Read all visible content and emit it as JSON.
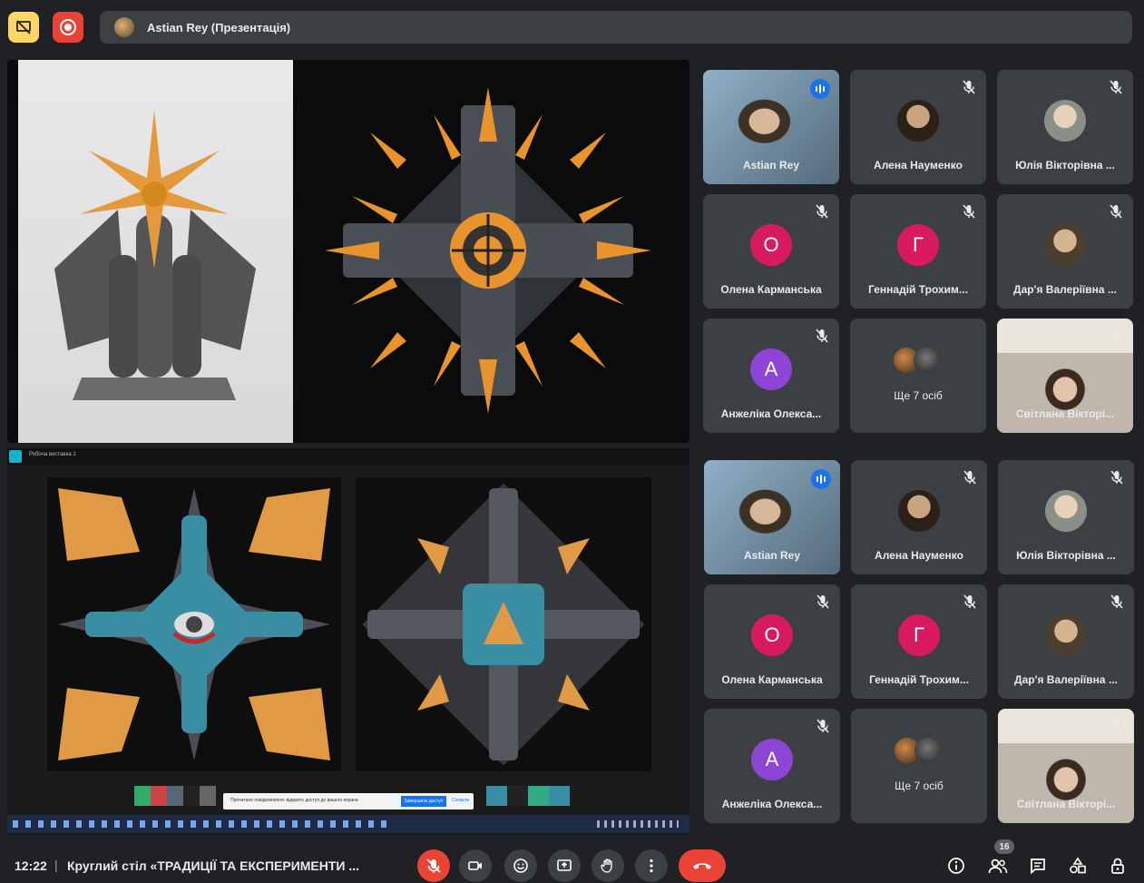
{
  "top_bar": {
    "presenter_label": "Astian Rey (Презентація)",
    "present_icon": "present-off-icon",
    "record_icon": "record-icon"
  },
  "presentation": {
    "upper_window": {
      "artworks": [
        "sculpture-photo",
        "kaleidoscope-mandala"
      ]
    },
    "lower_window": {
      "title": "Робоча виставка 1",
      "notice_text": "Прочитано повідомлення: відкрито доступ до вашого екрана",
      "notice_button": "Завершити доступ",
      "notice_dismiss": "Сховати"
    }
  },
  "participants_top": [
    {
      "name": "Astian Rey",
      "type": "video",
      "speaking": true
    },
    {
      "name": "Алена Науменко",
      "type": "photo",
      "muted": true
    },
    {
      "name": "Юлія Вікторівна ...",
      "type": "photo",
      "muted": true
    },
    {
      "name": "Олена Карманська",
      "type": "letter",
      "letter": "О",
      "color": "#d81b60",
      "muted": true
    },
    {
      "name": "Геннадій Трохим...",
      "type": "letter",
      "letter": "Г",
      "color": "#d81b60",
      "muted": true
    },
    {
      "name": "Дар'я Валеріївна ...",
      "type": "photo",
      "muted": true
    },
    {
      "name": "Анжеліка Олекса...",
      "type": "letter",
      "letter": "А",
      "color": "#8e44d4",
      "muted": true
    },
    {
      "name": "Ще 7 осіб",
      "type": "more"
    },
    {
      "name": "Світлана Вікторі...",
      "type": "video",
      "muted": true
    }
  ],
  "participants_bottom": [
    {
      "name": "Astian Rey",
      "type": "video",
      "speaking": true
    },
    {
      "name": "Алена Науменко",
      "type": "photo",
      "muted": true
    },
    {
      "name": "Юлія Вікторівна ...",
      "type": "photo",
      "muted": true
    },
    {
      "name": "Олена Карманська",
      "type": "letter",
      "letter": "О",
      "color": "#d81b60",
      "muted": true
    },
    {
      "name": "Геннадій Трохим...",
      "type": "letter",
      "letter": "Г",
      "color": "#d81b60",
      "muted": true
    },
    {
      "name": "Дар'я Валеріївна ...",
      "type": "photo",
      "muted": true
    },
    {
      "name": "Анжеліка Олекса...",
      "type": "letter",
      "letter": "А",
      "color": "#8e44d4",
      "muted": true
    },
    {
      "name": "Ще 7 осіб",
      "type": "more"
    },
    {
      "name": "Світлана Вікторі...",
      "type": "video",
      "muted": true
    }
  ],
  "bottom_bar": {
    "time": "12:22",
    "separator": "|",
    "meeting_title": "Круглий стіл «ТРАДИЦІЇ ТА ЕКСПЕРИМЕНТИ ...",
    "participants_count": "16",
    "controls": [
      "mic-off-icon",
      "camera-off-icon",
      "emoji-icon",
      "present-icon",
      "raise-hand-icon",
      "more-options-icon",
      "hang-up-icon"
    ],
    "right_icons": [
      "info-icon",
      "people-icon",
      "chat-icon",
      "activities-icon",
      "host-controls-icon"
    ]
  }
}
